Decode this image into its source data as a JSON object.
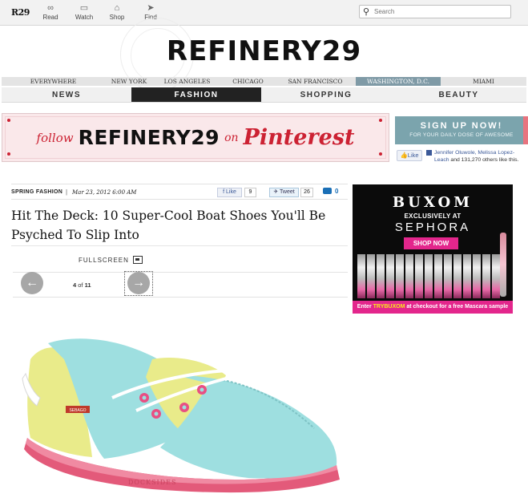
{
  "topbar": {
    "logo": "R29",
    "nav": [
      {
        "label": "Read",
        "icon": "glasses-icon"
      },
      {
        "label": "Watch",
        "icon": "tv-icon"
      },
      {
        "label": "Shop",
        "icon": "basket-icon"
      },
      {
        "label": "Find",
        "icon": "location-arrow-icon"
      }
    ],
    "search_placeholder": "Search"
  },
  "masthead": {
    "title": "REFINERY29",
    "stamp_text": "WASHINGTON, D.C."
  },
  "cities": [
    "EVERYWHERE",
    "NEW YORK",
    "LOS ANGELES",
    "CHICAGO",
    "SAN FRANCISCO",
    "WASHINGTON, D.C.",
    "MIAMI"
  ],
  "active_city": "WASHINGTON, D.C.",
  "sections": [
    "NEWS",
    "FASHION",
    "SHOPPING",
    "BEAUTY"
  ],
  "active_section": "FASHION",
  "pinterest_banner": {
    "follow": "follow",
    "brand": "REFINERY29",
    "on": "on",
    "pinterest": "Pinterest"
  },
  "signup": {
    "title": "SIGN UP NOW!",
    "subtitle": "FOR YOUR DAILY DOSE OF AWESOME"
  },
  "facebook": {
    "like_label": "Like",
    "names": "Jennifer Oluwole, Melissa Lopez-Leach",
    "social_text": " and 131,270 others like this."
  },
  "article": {
    "category": "SPRING FASHION",
    "separator": "|",
    "date": "Mar 23, 2012 6:00 AM",
    "fb_like_label": "Like",
    "fb_like_count": "9",
    "tweet_label": "Tweet",
    "tweet_count": "26",
    "comment_count": "0",
    "headline": "Hit The Deck: 10 Super-Cool Boat Shoes You'll Be Psyched To Slip Into"
  },
  "gallery": {
    "fullscreen_label": "FULLSCREEN",
    "current": "4",
    "of": "of",
    "total": "11",
    "prev_icon": "arrow-left-icon",
    "next_icon": "arrow-right-icon"
  },
  "ad": {
    "brand": "BUXOM",
    "exclusively": "EXCLUSIVELY AT",
    "retailer": "SEPHORA",
    "cta": "SHOP NOW",
    "promo_pre": "Enter ",
    "promo_code": "TRYBUXOM",
    "promo_post": " at checkout for a free Mascara sample"
  },
  "product_image": {
    "tag": "SEBAGO",
    "sole_text": "DOCKSIDES"
  },
  "colors": {
    "accent_teal": "#7f9aa6",
    "signup_bg": "#7ba4ad",
    "pinterest_red": "#cc2233",
    "ad_pink": "#e3268c",
    "facebook_blue": "#3b5998"
  }
}
